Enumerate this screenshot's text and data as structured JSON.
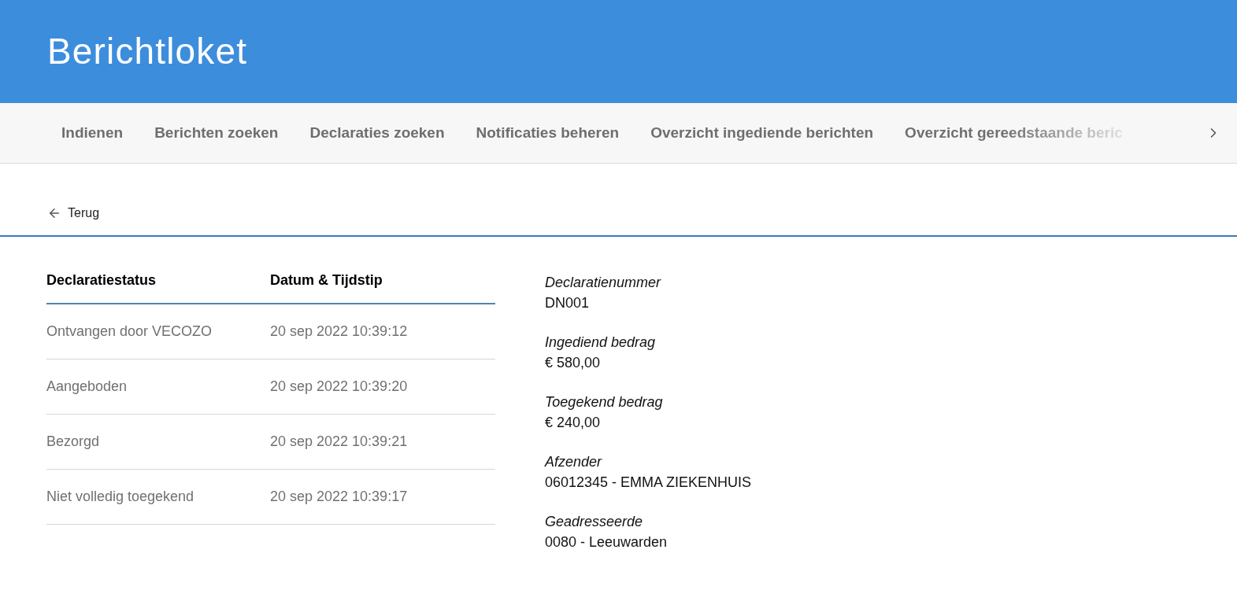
{
  "header": {
    "title": "Berichtloket"
  },
  "nav": {
    "tabs": [
      {
        "label": "Indienen"
      },
      {
        "label": "Berichten zoeken"
      },
      {
        "label": "Declaraties zoeken"
      },
      {
        "label": "Notificaties beheren"
      },
      {
        "label": "Overzicht ingediende berichten"
      },
      {
        "label": "Overzicht gereedstaande beric"
      }
    ]
  },
  "back_link": "Terug",
  "status_table": {
    "columns": [
      "Declaratiestatus",
      "Datum & Tijdstip"
    ],
    "rows": [
      [
        "Ontvangen door VECOZO",
        "20 sep 2022 10:39:12"
      ],
      [
        "Aangeboden",
        "20 sep 2022 10:39:20"
      ],
      [
        "Bezorgd",
        "20 sep 2022 10:39:21"
      ],
      [
        "Niet volledig toegekend",
        "20 sep 2022 10:39:17"
      ]
    ]
  },
  "details": [
    {
      "label": "Declaratienummer",
      "value": "DN001"
    },
    {
      "label": "Ingediend bedrag",
      "value": "€ 580,00"
    },
    {
      "label": "Toegekend bedrag",
      "value": "€ 240,00"
    },
    {
      "label": "Afzender",
      "value": "06012345 - EMMA ZIEKENHUIS"
    },
    {
      "label": "Geadresseerde",
      "value": "0080 - Leeuwarden"
    }
  ]
}
